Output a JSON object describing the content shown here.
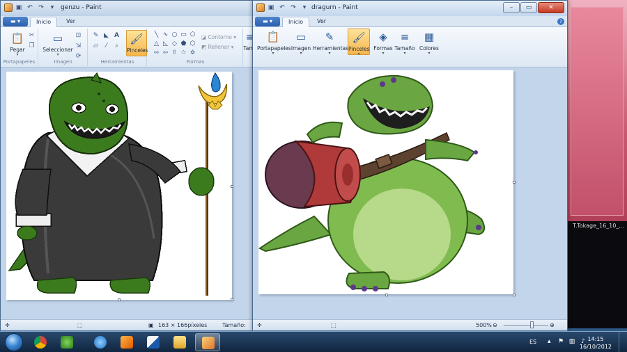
{
  "window1": {
    "title": "genzu - Paint",
    "tabs": [
      "Inicio",
      "Ver"
    ],
    "groups": {
      "clipboard_label": "Portapapeles",
      "image_label": "Imagen",
      "tools_label": "Herramientas",
      "shapes_label": "Formas"
    },
    "buttons": {
      "paste": "Pegar",
      "select": "Seleccionar",
      "brushes": "Pinceles",
      "size_partial": "Tam",
      "outline": "Contorno",
      "fill": "Rellenar"
    },
    "status": {
      "dimensions": "163 × 166píxeles",
      "size_label": "Tamaño:"
    }
  },
  "window2": {
    "title": "dragurn - Paint",
    "tabs": [
      "Inicio",
      "Ver"
    ],
    "buttons": {
      "clipboard": "Portapapeles",
      "image": "Imagen",
      "tools": "Herramientas",
      "brushes": "Pinceles",
      "shapes": "Formas",
      "size": "Tamaño",
      "colors": "Colores"
    },
    "status": {
      "zoom": "500%"
    }
  },
  "desktop": {
    "thumb_label_a": "T...",
    "thumb_label_b": "Tokage_16_10_..."
  },
  "taskbar": {
    "lang": "ES",
    "time": "14:15",
    "date": "16/10/2012"
  },
  "colors": {
    "ribbon_active": "#f7b54a",
    "title_close": "#c43a22",
    "canvas_bg": "#c3d5ea"
  }
}
